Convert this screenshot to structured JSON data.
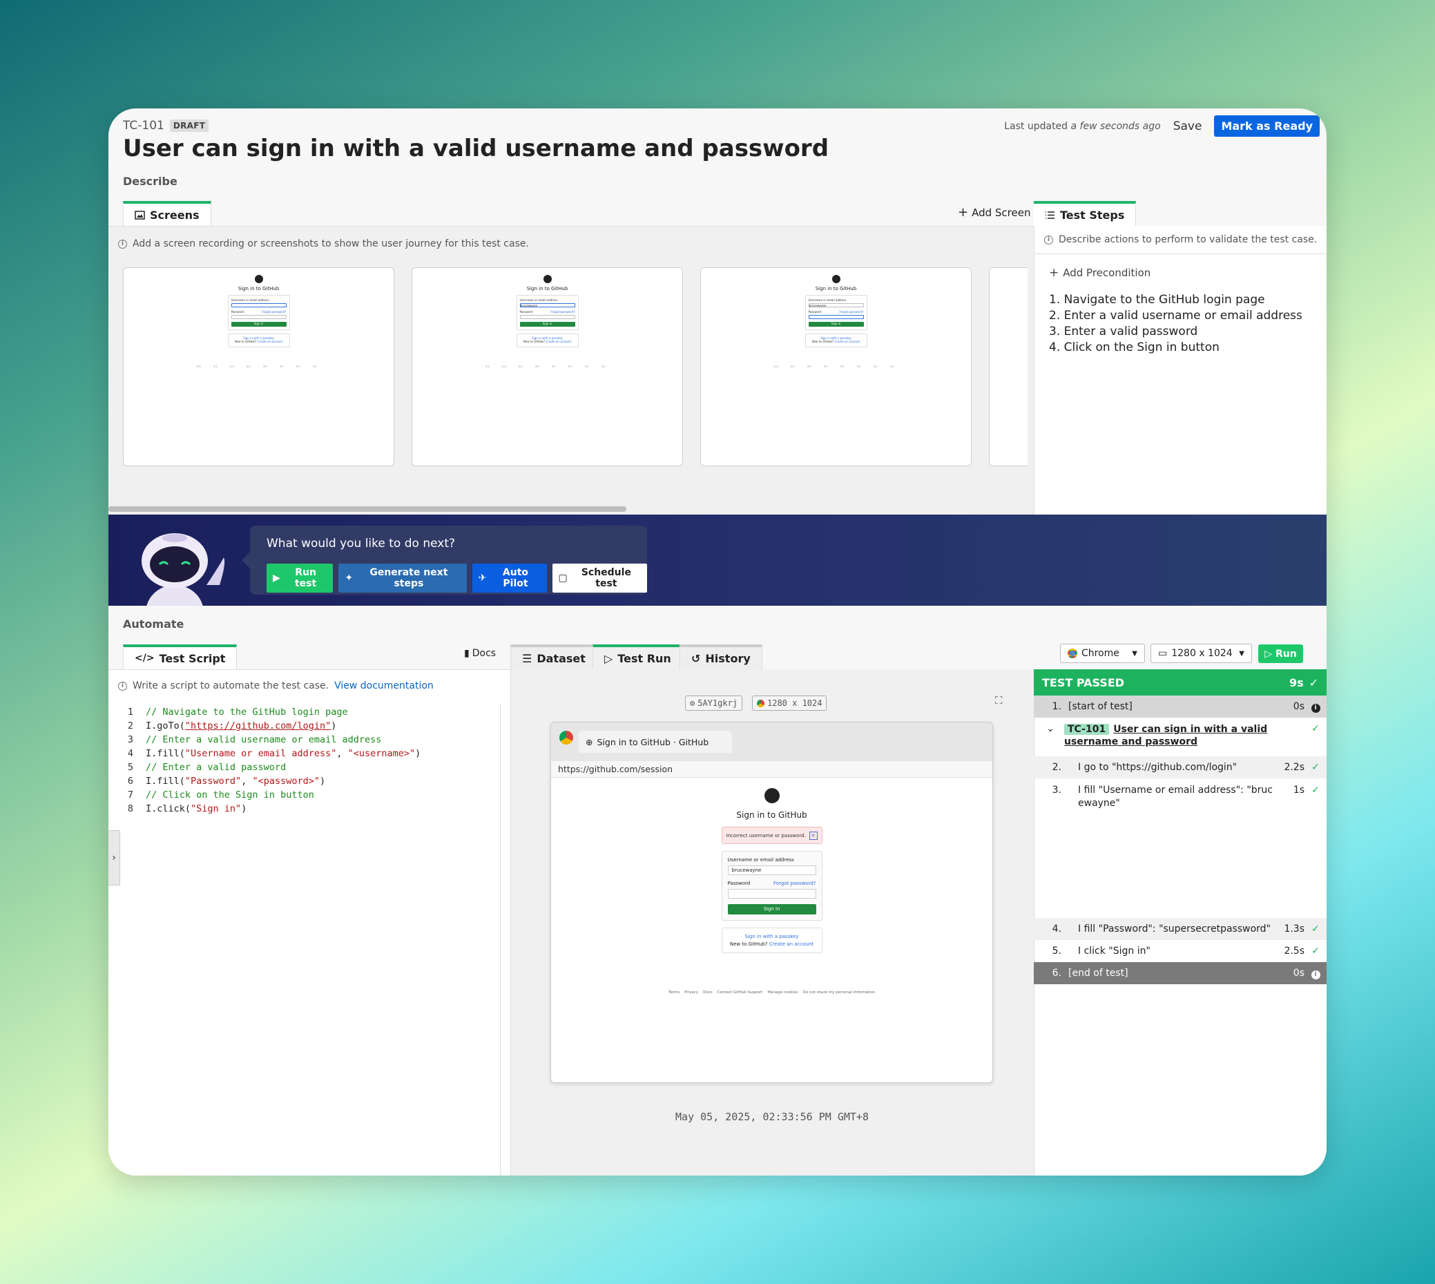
{
  "header": {
    "id": "TC-101",
    "badge": "DRAFT",
    "title": "User can sign in with a valid username and password",
    "last_updated_prefix": "Last updated",
    "last_updated_value": "a few seconds ago",
    "save_label": "Save",
    "ready_label": "Mark as Ready"
  },
  "describe": {
    "section_label": "Describe",
    "screens_tab": "Screens",
    "add_screen": "Add Screen",
    "screens_info": "Add a screen recording or screenshots to show the user journey for this test case.",
    "thumbs": [
      {
        "title": "Sign in to GitHub",
        "user_label": "Username or email address",
        "user_value": "",
        "pass_label": "Password",
        "forgot": "Forgot password?",
        "btn": "Sign in",
        "passkey": "Sign in with a passkey",
        "new": "New to GitHub?",
        "create": "Create an account"
      },
      {
        "title": "Sign in to GitHub",
        "user_label": "Username or email address",
        "user_value": "brucewayne",
        "pass_label": "Password",
        "forgot": "Forgot password?",
        "btn": "Sign in",
        "passkey": "Sign in with a passkey",
        "new": "New to GitHub?",
        "create": "Create an account"
      },
      {
        "title": "Sign in to GitHub",
        "user_label": "Username or email address",
        "user_value": "brucewayne",
        "pass_label": "Password",
        "forgot": "Forgot password?",
        "btn": "Sign in",
        "passkey": "Sign in with a passkey",
        "new": "New to GitHub?",
        "create": "Create an account"
      }
    ],
    "steps_tab": "Test Steps",
    "steps_info": "Describe actions to perform to validate the test case.",
    "add_precondition": "Add Precondition",
    "steps": [
      "1. Navigate to the GitHub login page",
      "2. Enter a valid username or email address",
      "3. Enter a valid password",
      "4. Click on the Sign in button"
    ]
  },
  "banner": {
    "question": "What would you like to do next?",
    "run_test": "Run test",
    "generate": "Generate next steps",
    "autopilot": "Auto Pilot",
    "schedule": "Schedule test"
  },
  "automate": {
    "section_label": "Automate",
    "script_tab": "Test Script",
    "docs": "Docs",
    "info": "Write a script to automate the test case.",
    "info_link": "View documentation",
    "tabs": [
      "Dataset",
      "Test Run",
      "History"
    ],
    "browser_select": "Chrome",
    "resolution_select": "1280 x 1024",
    "run_label": "Run",
    "run_id": "5AY1gkrj",
    "run_res": "1280 x 1024",
    "browser_tab_title": "Sign in to GitHub · GitHub",
    "browser_url": "https://github.com/session",
    "gh_title": "Sign in to GitHub",
    "gh_error": "Incorrect username or password.",
    "gh_user_label": "Username or email address",
    "gh_user_value": "brucewayne",
    "gh_pass_label": "Password",
    "gh_forgot": "Forgot password?",
    "gh_btn": "Sign in",
    "gh_passkey": "Sign in with a passkey",
    "gh_new": "New to GitHub?",
    "gh_create": "Create an account",
    "gh_footer": [
      "Terms",
      "Privacy",
      "Docs",
      "Contact GitHub Support",
      "Manage cookies",
      "Do not share my personal information"
    ],
    "timestamp": "May 05, 2025, 02:33:56 PM GMT+8"
  },
  "code": [
    {
      "n": "1",
      "parts": [
        {
          "c": "cm",
          "t": "// Navigate to the GitHub login page"
        }
      ]
    },
    {
      "n": "2",
      "parts": [
        {
          "c": "",
          "t": "I.goTo("
        },
        {
          "c": "str",
          "t": "\"https://github.com/login\""
        },
        {
          "c": "",
          "t": ")"
        }
      ]
    },
    {
      "n": "3",
      "parts": [
        {
          "c": "cm",
          "t": "// Enter a valid username or email address"
        }
      ]
    },
    {
      "n": "4",
      "parts": [
        {
          "c": "",
          "t": "I.fill("
        },
        {
          "c": "str",
          "t": "\"Username or email address\""
        },
        {
          "c": "",
          "t": ", "
        },
        {
          "c": "str",
          "t": "\"<username>\""
        },
        {
          "c": "",
          "t": ")"
        }
      ]
    },
    {
      "n": "5",
      "parts": [
        {
          "c": "cm",
          "t": "// Enter a valid password"
        }
      ]
    },
    {
      "n": "6",
      "parts": [
        {
          "c": "",
          "t": "I.fill("
        },
        {
          "c": "str",
          "t": "\"Password\""
        },
        {
          "c": "",
          "t": ", "
        },
        {
          "c": "str",
          "t": "\"<password>\""
        },
        {
          "c": "",
          "t": ")"
        }
      ]
    },
    {
      "n": "7",
      "parts": [
        {
          "c": "cm",
          "t": "// Click on the Sign in button"
        }
      ]
    },
    {
      "n": "8",
      "parts": [
        {
          "c": "",
          "t": "I.click("
        },
        {
          "c": "str",
          "t": "\"Sign in\""
        },
        {
          "c": "",
          "t": ")"
        }
      ]
    }
  ],
  "results": {
    "status": "TEST PASSED",
    "duration": "9s",
    "start": {
      "n": "1.",
      "d": "[start of test]",
      "t": "0s"
    },
    "case_id": "TC-101",
    "case_title": "User can sign in with a valid username and password",
    "rows": [
      {
        "n": "2.",
        "d": "I go to \"https://github.com/login\"",
        "t": "2.2s"
      },
      {
        "n": "3.",
        "d": "I fill \"Username or email address\": \"brucewayne\"",
        "t": "1s"
      },
      {
        "n": "4.",
        "d": "I fill \"Password\": \"supersecretpassword\"",
        "t": "1.3s"
      },
      {
        "n": "5.",
        "d": "I click \"Sign in\"",
        "t": "2.5s"
      }
    ],
    "end": {
      "n": "6.",
      "d": "[end of test]",
      "t": "0s"
    }
  },
  "colors": {
    "accent_green": "#1db35e",
    "primary_blue": "#0a66e0",
    "banner_navy": "#1a1f5c"
  }
}
